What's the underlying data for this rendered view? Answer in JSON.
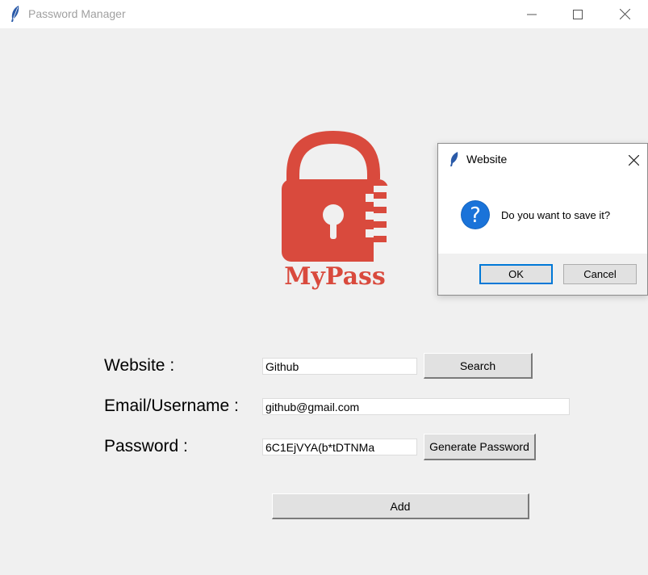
{
  "window": {
    "title": "Password Manager"
  },
  "logo": {
    "text": "MyPass",
    "color": "#d94a3d"
  },
  "form": {
    "website_label": "Website :",
    "email_label": "Email/Username :",
    "password_label": "Password :",
    "website_value": "Github",
    "email_value": "github@gmail.com",
    "password_value": "6C1EjVYA(b*tDTNMa",
    "search_button": "Search",
    "generate_button": "Generate Password",
    "add_button": "Add"
  },
  "dialog": {
    "title": "Website",
    "message": "Do you want to save it?",
    "ok_button": "OK",
    "cancel_button": "Cancel",
    "icon": "question-icon",
    "accent": "#0078d7"
  }
}
